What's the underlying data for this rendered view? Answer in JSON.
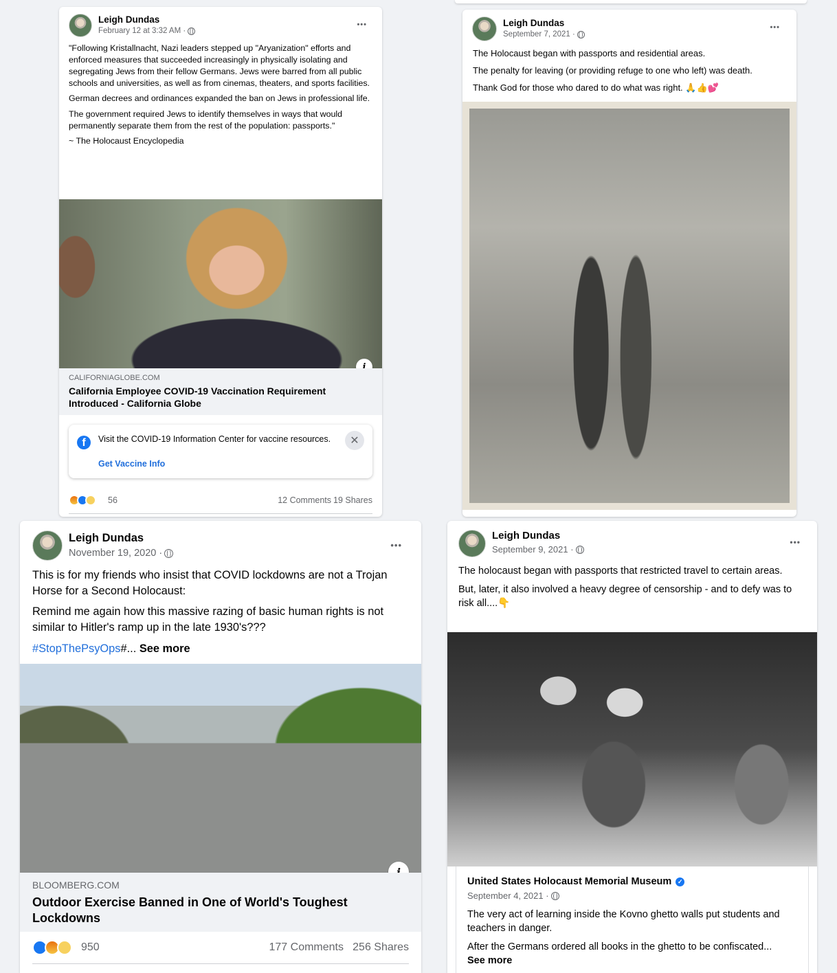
{
  "post1": {
    "author": "Leigh Dundas",
    "time": "February 12 at 3:32 AM ·",
    "paragraphs": [
      "\"Following Kristallnacht, Nazi leaders stepped up \"Aryanization\" efforts and enforced measures that succeeded increasingly in physically isolating and segregating Jews from their fellow Germans. Jews were barred from all public schools and universities, as well as from cinemas, theaters, and sports facilities.",
      "German decrees and ordinances expanded the ban on Jews in professional life.",
      "The government required Jews to identify themselves in ways that would permanently separate them from the rest of the population: passports.\"",
      "~ The Holocaust Encyclopedia"
    ],
    "link_domain": "CALIFORNIAGLOBE.COM",
    "link_title": "California Employee COVID-19 Vaccination Requirement Introduced - California Globe",
    "vaccine_text": "Visit the COVID-19 Information Center for vaccine resources.",
    "vaccine_link": "Get Vaccine Info",
    "reaction_count": "56",
    "comments": "12 Comments",
    "shares": "19 Shares"
  },
  "post2": {
    "author": "Leigh Dundas",
    "time": "September 7, 2021 ·",
    "paragraphs": [
      "The Holocaust began with passports and residential areas.",
      "The penalty for leaving (or providing refuge to one who left) was death.",
      "Thank God for those who dared to do what was right. 🙏👍💕"
    ]
  },
  "post3": {
    "author": "Leigh Dundas",
    "time": "November 19, 2020 ·",
    "paragraphs": [
      "This is for my friends who insist that COVID lockdowns are not a Trojan Horse for a Second Holocaust:",
      "Remind me again how this massive razing of basic human rights is not similar to Hitler's ramp up in the late 1930's???"
    ],
    "hashtag": "#StopThePsyOps",
    "hashtag_tail": "#...",
    "see_more": "See more",
    "link_domain": "BLOOMBERG.COM",
    "link_title": "Outdoor Exercise Banned in One of World's Toughest Lockdowns",
    "reaction_count": "950",
    "comments": "177 Comments",
    "shares": "256 Shares"
  },
  "post4": {
    "author": "Leigh Dundas",
    "time": "September 9, 2021 ·",
    "paragraphs": [
      "The holocaust began with passports that restricted travel to certain areas.",
      "But, later, it also involved a heavy degree of censorship -  and to defy was to risk all....👇"
    ],
    "shared": {
      "page_name": "United States Holocaust Memorial Museum",
      "time": "September 4, 2021 ·",
      "paragraphs": [
        "The very act of learning inside the Kovno ghetto walls put students and teachers in danger.",
        "After the Germans ordered all books in the ghetto to be confiscated..."
      ],
      "see_more": "See more"
    }
  },
  "icons": {
    "more": "•••",
    "close": "✕",
    "info": "i",
    "verified": "✓",
    "fb": "f"
  }
}
